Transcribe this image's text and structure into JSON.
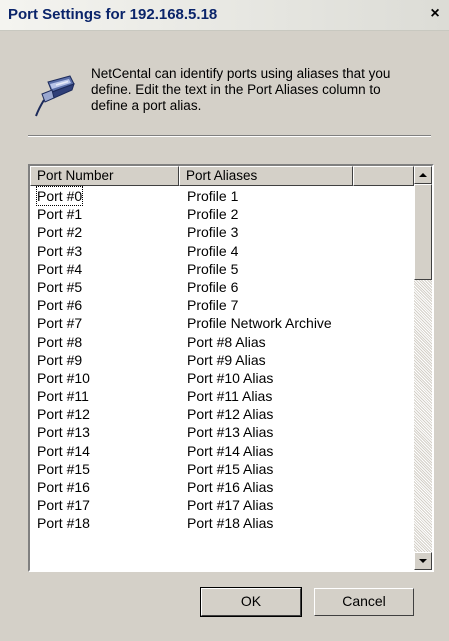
{
  "window": {
    "title": "Port Settings for 192.168.5.18",
    "close_glyph": "×"
  },
  "info": {
    "icon": "port-plug-icon",
    "text": "NetCental can identify ports using aliases that you define. Edit the text in the Port Aliases column to  define a port alias."
  },
  "table": {
    "columns": [
      "Port Number",
      "Port Aliases",
      ""
    ],
    "rows": [
      [
        "Port #0",
        "Profile 1"
      ],
      [
        "Port #1",
        "Profile 2"
      ],
      [
        "Port #2",
        "Profile 3"
      ],
      [
        "Port #3",
        "Profile 4"
      ],
      [
        "Port #4",
        "Profile 5"
      ],
      [
        "Port #5",
        "Profile 6"
      ],
      [
        "Port #6",
        "Profile 7"
      ],
      [
        "Port #7",
        "Profile Network Archive"
      ],
      [
        "Port #8",
        "Port #8 Alias"
      ],
      [
        "Port #9",
        "Port #9 Alias"
      ],
      [
        "Port #10",
        "Port #10 Alias"
      ],
      [
        "Port #11",
        "Port #11 Alias"
      ],
      [
        "Port #12",
        "Port #12 Alias"
      ],
      [
        "Port #13",
        "Port #13 Alias"
      ],
      [
        "Port #14",
        "Port #14 Alias"
      ],
      [
        "Port #15",
        "Port #15 Alias"
      ],
      [
        "Port #16",
        "Port #16 Alias"
      ],
      [
        "Port #17",
        "Port #17 Alias"
      ],
      [
        "Port #18",
        "Port #18 Alias"
      ]
    ],
    "focused_row": 0
  },
  "buttons": {
    "ok": "OK",
    "cancel": "Cancel"
  }
}
